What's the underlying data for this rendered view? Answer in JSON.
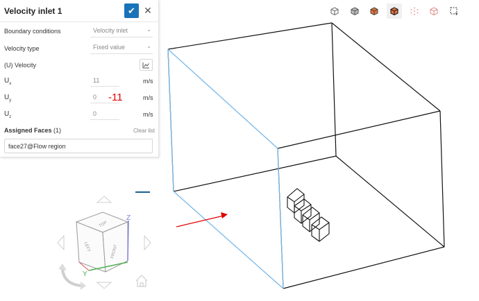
{
  "panel": {
    "title": "Velocity inlet 1",
    "boundary_label": "Boundary conditions",
    "boundary_value": "Velocity inlet",
    "velocity_type_label": "Velocity type",
    "velocity_type_value": "Fixed value",
    "velocity_label": "(U) Velocity",
    "components": [
      {
        "axis": "U",
        "sub": "x",
        "value": "11",
        "unit": "m/s"
      },
      {
        "axis": "U",
        "sub": "y",
        "value": "0",
        "unit": "m/s"
      },
      {
        "axis": "U",
        "sub": "z",
        "value": "0",
        "unit": "m/s"
      }
    ],
    "annotation": "-11",
    "assigned_faces_label": "Assigned Faces",
    "assigned_faces_count": "(1)",
    "clear_list": "Clear list",
    "face_item": "face27@Flow region"
  },
  "toolbar": {
    "icons": [
      "cube-icon",
      "cube-shaded-icon",
      "cube-orange-icon",
      "cube-orange-selected-icon",
      "points-icon",
      "cube-outline-icon",
      "box-select-icon"
    ]
  },
  "view_cube": {
    "face_top": "TOP",
    "face_front": "FRONT",
    "face_left": "LEFT",
    "axis_x": "X",
    "axis_y": "Y",
    "axis_z": "Z"
  },
  "colors": {
    "accent": "#1a73b8",
    "annotation": "#e00000",
    "edge_highlight": "#7ab8e8",
    "axis_y": "#4caf50",
    "axis_z": "#7b7fd6"
  }
}
